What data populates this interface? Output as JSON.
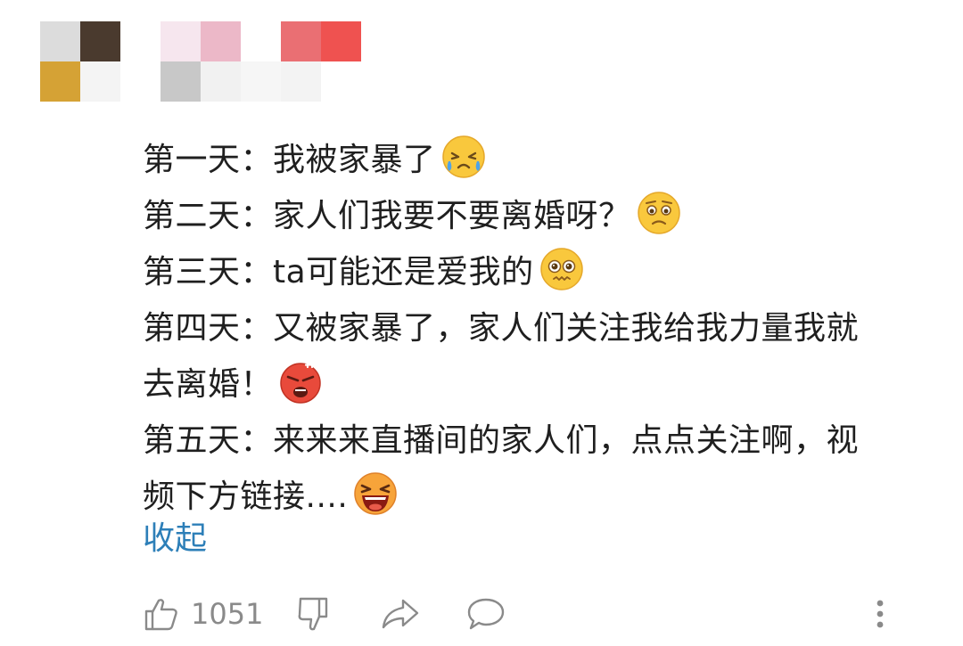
{
  "comment": {
    "lines": [
      "第一天：我被家暴了",
      "第二天：家人们我要不要离婚呀？",
      "第三天：ta可能还是爱我的",
      "第四天：又被家暴了，家人们关注我给我力量我就",
      "去离婚！",
      "第五天：来来来直播间的家人们，点点关注啊，视",
      "频下方链接...."
    ],
    "emojis": [
      "crying-emoji",
      "worried-emoji",
      "pleading-emoji",
      "angry-emoji",
      "laughing-emoji"
    ],
    "collapse_label": "收起"
  },
  "actions": {
    "like_count": "1051",
    "icons": [
      "thumbs-up-icon",
      "thumbs-down-icon",
      "share-icon",
      "reply-icon",
      "more-icon"
    ]
  },
  "colors": {
    "text": "#1f1f1f",
    "link": "#2d7fb8",
    "icon": "#8a8a8a"
  }
}
